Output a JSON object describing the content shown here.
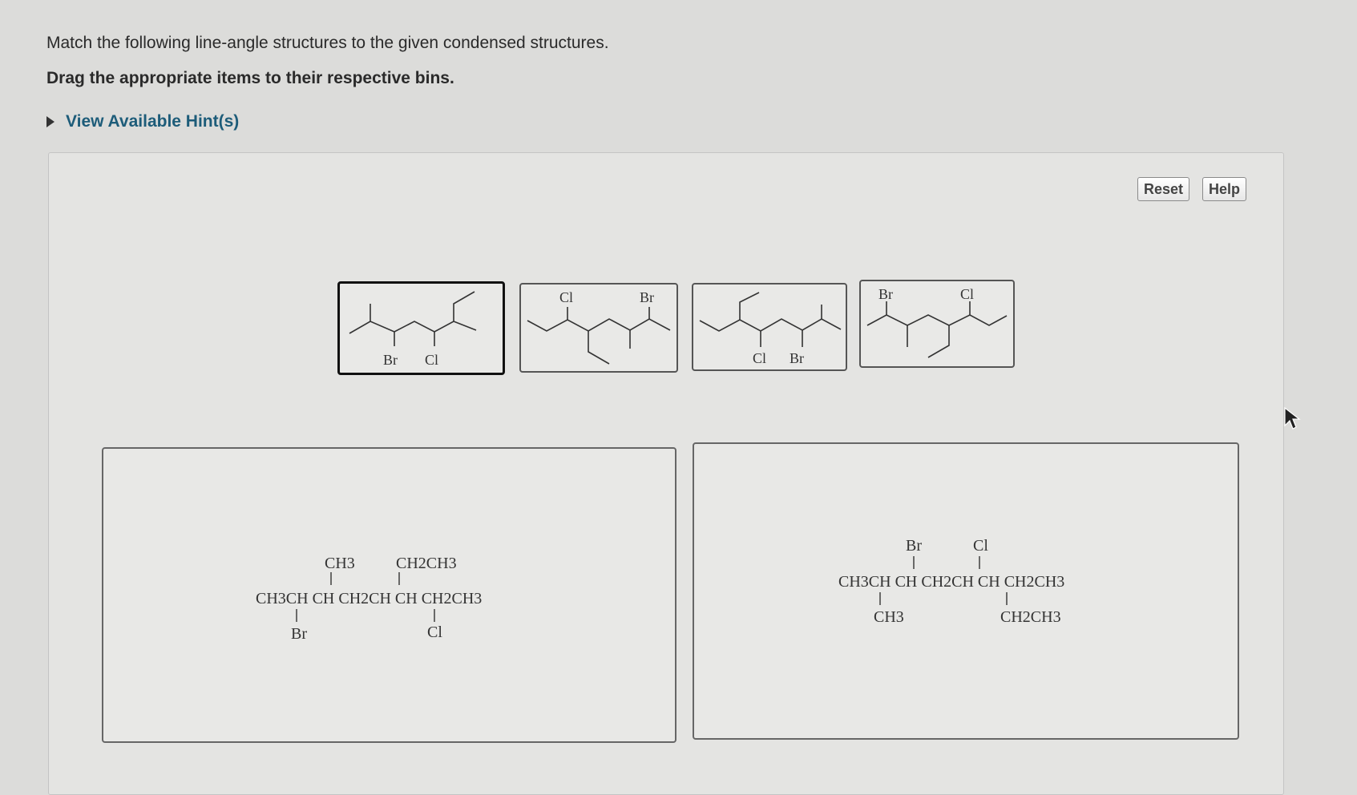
{
  "instructions": {
    "question": "Match the following line-angle structures to the given condensed structures.",
    "directive": "Drag the appropriate items to their respective bins.",
    "hint_link": "View Available Hint(s)"
  },
  "toolbar": {
    "reset": "Reset",
    "help": "Help"
  },
  "tiles": [
    {
      "labels": [
        "Br",
        "Cl"
      ]
    },
    {
      "labels": [
        "Cl",
        "Br"
      ]
    },
    {
      "labels": [
        "Cl",
        "Br"
      ]
    },
    {
      "labels": [
        "Br",
        "Cl"
      ]
    }
  ],
  "bins": [
    {
      "top_groups": [
        "CH3",
        "CH2CH3"
      ],
      "main_chain": "CH3CH CH CH2CH CH CH2CH3",
      "bottom_groups": [
        "Br",
        "Cl"
      ]
    },
    {
      "top_groups": [
        "Br",
        "Cl"
      ],
      "main_chain": "CH3CH CH CH2CH CH CH2CH3",
      "bottom_groups": [
        "CH3",
        "CH2CH3"
      ]
    }
  ]
}
